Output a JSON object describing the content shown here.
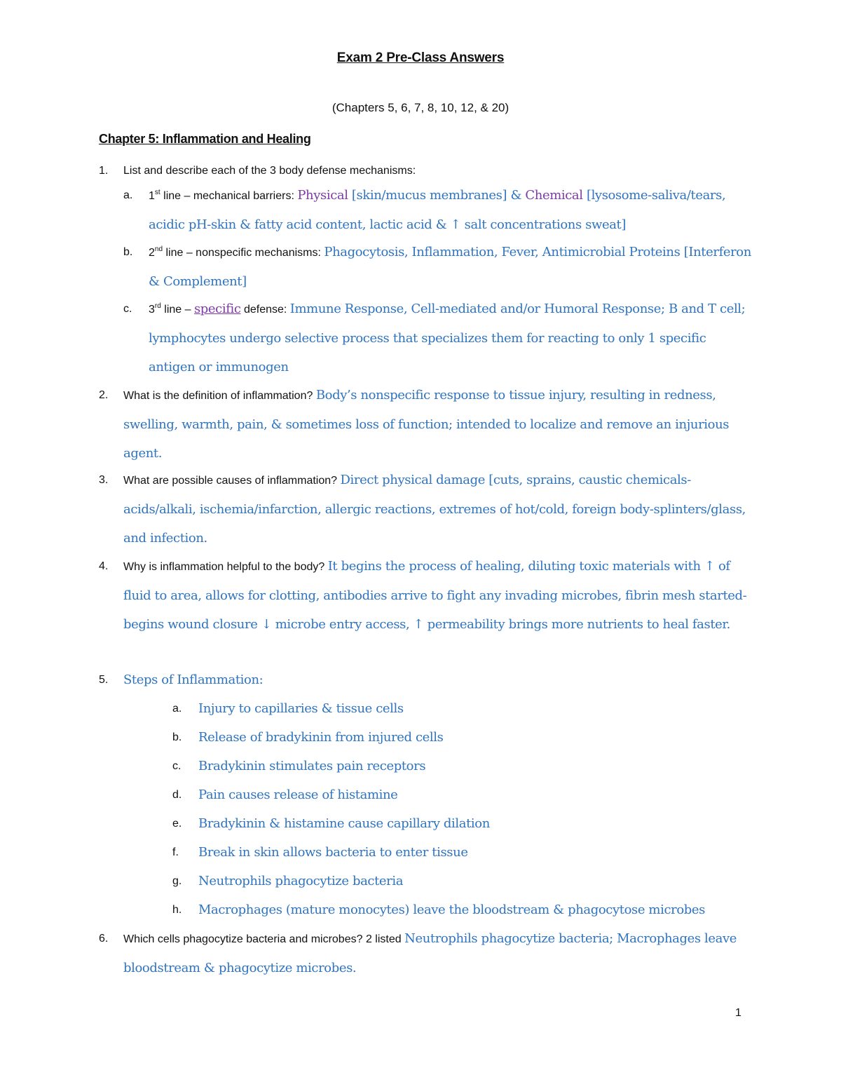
{
  "document": {
    "title": "Exam 2 Pre-Class Answers",
    "subtitle": "(Chapters 5, 6, 7, 8, 10, 12, & 20)",
    "chapter_heading": "Chapter 5: Inflammation and Healing",
    "page_number": "1"
  },
  "colors": {
    "answer_blue": "#2F74C0",
    "highlight_purple": "#7E3AA8",
    "text": "#111111"
  },
  "questions": [
    {
      "number": "1.",
      "question": "List and describe each of the 3 body defense mechanisms:",
      "sub": [
        {
          "letter": "a.",
          "ordinal": "1",
          "ordinal_suffix": "st",
          "label": " line – mechanical barriers: ",
          "parts": [
            "Physical",
            " [skin/mucus membranes] & ",
            "Chemical",
            " [lysosome-saliva/tears, acidic pH-skin & fatty acid content, lactic acid & ↑ salt concentrations sweat]"
          ]
        },
        {
          "letter": "b.",
          "ordinal": "2",
          "ordinal_suffix": "nd",
          "label": " line – nonspecific mechanisms: ",
          "answer": "Phagocytosis, Inflammation, Fever, Antimicrobial Proteins [Interferon & Complement]"
        },
        {
          "letter": "c.",
          "ordinal": "3",
          "ordinal_suffix": "rd",
          "label_pre": " line – ",
          "label_emph": "specific",
          "label_post": " defense: ",
          "answer": "Immune Response, Cell-mediated and/or Humoral Response; B and T cell; lymphocytes undergo selective process that specializes them for reacting to only 1 specific antigen or immunogen"
        }
      ]
    },
    {
      "number": "2.",
      "question": "What is the definition of inflammation? ",
      "answer": "Body’s nonspecific response to tissue injury, resulting in redness, swelling, warmth, pain, & sometimes loss of function; intended to localize and remove an injurious agent."
    },
    {
      "number": "3.",
      "question": "What are possible causes of inflammation? ",
      "answer": "Direct physical damage [cuts, sprains, caustic chemicals-acids/alkali, ischemia/infarction, allergic reactions, extremes of hot/cold, foreign body-splinters/glass, and infection."
    },
    {
      "number": "4.",
      "question": "Why is inflammation helpful to the body? ",
      "answer": "It begins the process of healing, diluting toxic materials with ↑ of fluid to area, allows for clotting, antibodies arrive to fight any invading microbes, fibrin mesh started-begins wound closure ↓ microbe entry access, ↑ permeability brings more nutrients to heal faster."
    },
    {
      "number": "5.",
      "answer": "Steps of Inflammation:",
      "steps": [
        {
          "letter": "a.",
          "text": "Injury to capillaries & tissue cells"
        },
        {
          "letter": "b.",
          "text": "Release of bradykinin from injured cells"
        },
        {
          "letter": "c.",
          "text": "Bradykinin stimulates pain receptors"
        },
        {
          "letter": "d.",
          "text": "Pain causes release of histamine"
        },
        {
          "letter": "e.",
          "text": "Bradykinin & histamine cause capillary dilation"
        },
        {
          "letter": "f.",
          "text": "Break in skin allows bacteria to enter tissue"
        },
        {
          "letter": "g.",
          "text": "Neutrophils phagocytize bacteria"
        },
        {
          "letter": "h.",
          "text": "Macrophages (mature monocytes) leave the bloodstream & phagocytose microbes"
        }
      ]
    },
    {
      "number": "6.",
      "question": "Which cells phagocytize bacteria and microbes? 2 listed ",
      "answer": "Neutrophils phagocytize bacteria; Macrophages leave bloodstream & phagocytize microbes."
    }
  ]
}
